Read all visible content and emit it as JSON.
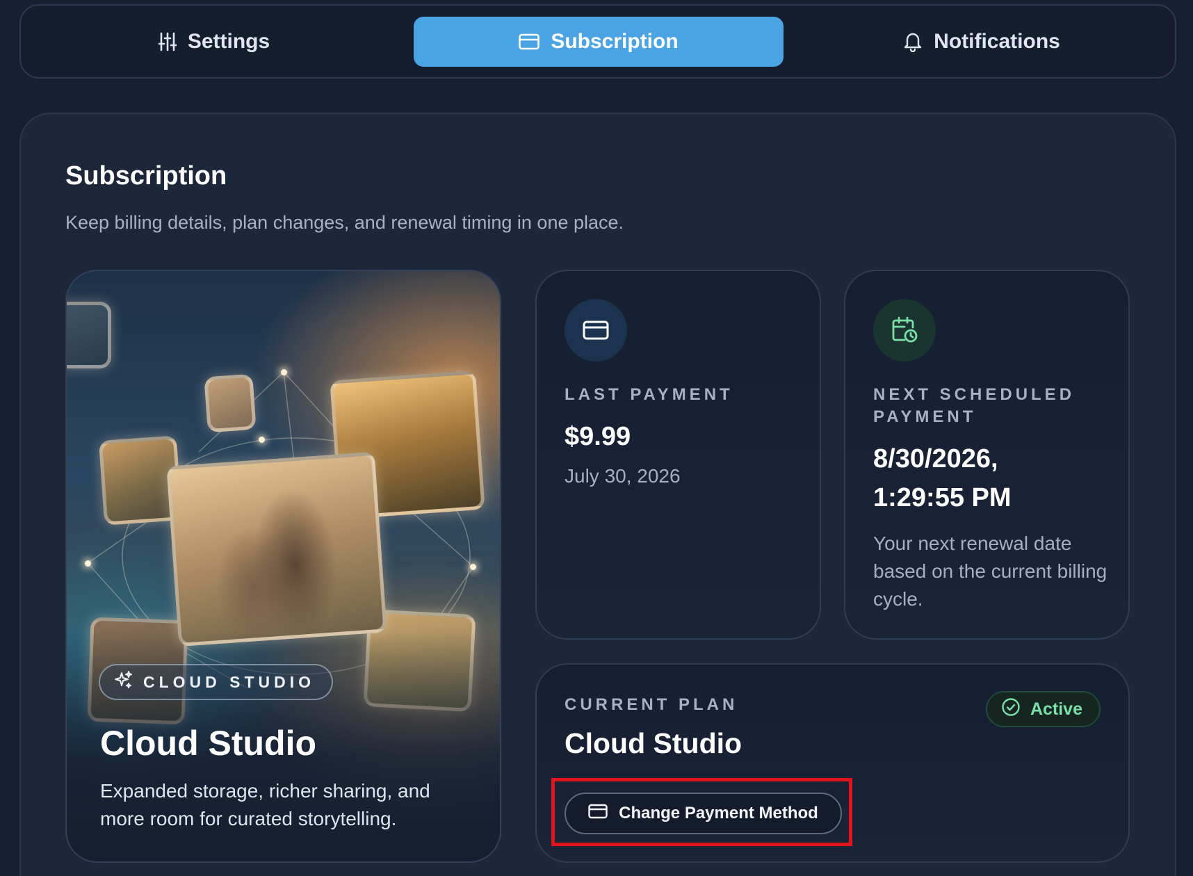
{
  "tabs": [
    {
      "label": "Settings",
      "icon": "sliders-icon",
      "active": false
    },
    {
      "label": "Subscription",
      "icon": "credit-card-icon",
      "active": true
    },
    {
      "label": "Notifications",
      "icon": "bell-icon",
      "active": false
    }
  ],
  "page": {
    "title": "Subscription",
    "subtitle": "Keep billing details, plan changes, and renewal timing in one place."
  },
  "hero": {
    "badge": "CLOUD STUDIO",
    "badge_icon": "sparkles-icon",
    "title": "Cloud Studio",
    "description": "Expanded storage, richer sharing, and more room for curated storytelling."
  },
  "last_payment": {
    "icon": "credit-card-icon",
    "label": "LAST PAYMENT",
    "amount": "$9.99",
    "date": "July 30, 2026"
  },
  "next_payment": {
    "icon": "calendar-clock-icon",
    "label": "NEXT SCHEDULED PAYMENT",
    "datetime_line1": "8/30/2026,",
    "datetime_line2": "1:29:55 PM",
    "note": "Your next renewal date based on the current billing cycle."
  },
  "current_plan": {
    "label": "CURRENT PLAN",
    "name": "Cloud Studio",
    "status": "Active",
    "status_icon": "check-circle-icon",
    "button_label": "Change Payment Method",
    "button_icon": "credit-card-icon"
  },
  "colors": {
    "background": "#162033",
    "accent": "#4aa3e2",
    "status_green": "#7be0a8",
    "highlight_red": "#e0161c"
  }
}
